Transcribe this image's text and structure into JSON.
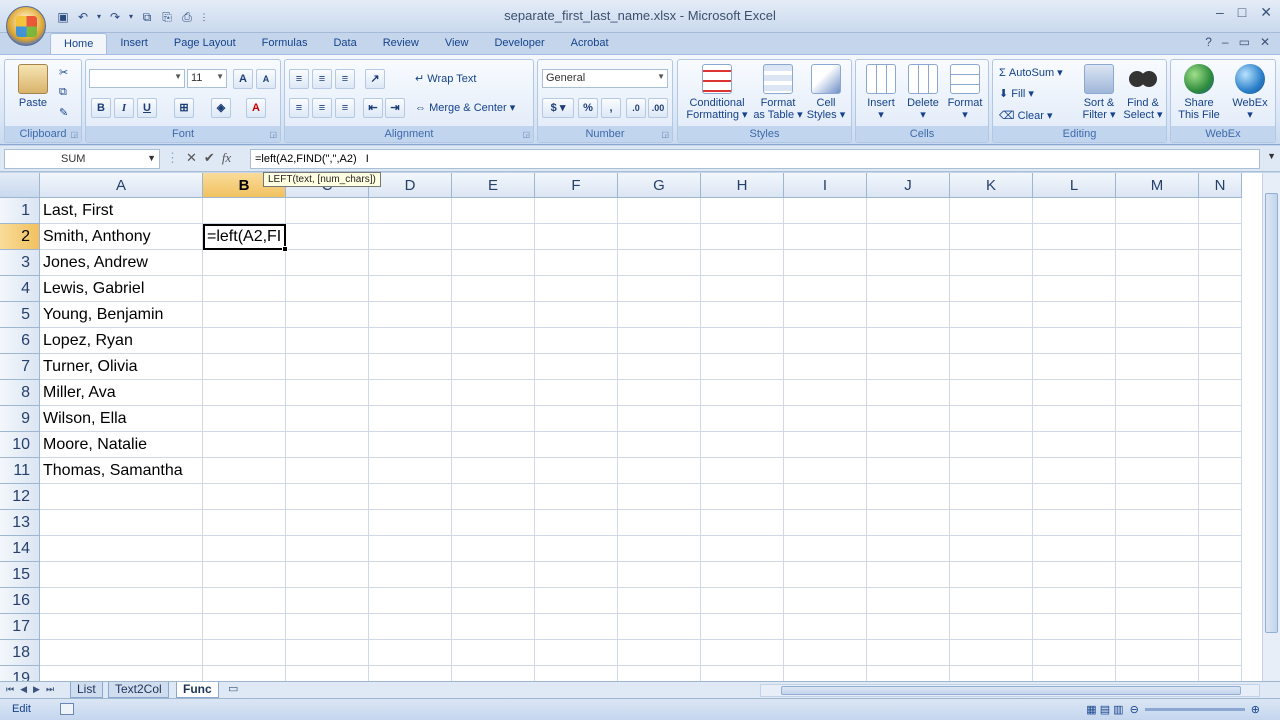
{
  "window": {
    "title": "separate_first_last_name.xlsx - Microsoft Excel",
    "controls": [
      "–",
      "□",
      "✕"
    ]
  },
  "ribbon": {
    "tabs": [
      "Home",
      "Insert",
      "Page Layout",
      "Formulas",
      "Data",
      "Review",
      "View",
      "Developer",
      "Acrobat"
    ],
    "active_tab": "Home",
    "clipboard": {
      "label": "Clipboard",
      "paste": "Paste"
    },
    "font": {
      "label": "Font",
      "name": "",
      "size": "11",
      "bold": "B",
      "italic": "I",
      "underline": "U",
      "grow": "A",
      "shrink": "A"
    },
    "alignment": {
      "label": "Alignment",
      "wrap": "Wrap Text",
      "merge": "Merge & Center"
    },
    "number": {
      "label": "Number",
      "format": "General",
      "currency": "$",
      "percent": "%",
      "comma": ","
    },
    "styles": {
      "label": "Styles",
      "conditional": "Conditional Formatting",
      "cond_l1": "Conditional",
      "cond_l2": "Formatting",
      "table_l1": "Format",
      "table_l2": "as Table",
      "cell_l1": "Cell",
      "cell_l2": "Styles"
    },
    "cells": {
      "label": "Cells",
      "insert": "Insert",
      "delete": "Delete",
      "format": "Format"
    },
    "editing": {
      "label": "Editing",
      "autosum": "AutoSum",
      "fill": "Fill",
      "clear": "Clear",
      "sort_l1": "Sort &",
      "sort_l2": "Filter",
      "find_l1": "Find &",
      "find_l2": "Select"
    },
    "webex": {
      "label": "WebEx",
      "share_l1": "Share",
      "share_l2": "This File",
      "webex": "WebEx"
    }
  },
  "formula_bar": {
    "name_box": "SUM",
    "formula": "=left(A2,FIND(\",\",A2)",
    "tooltip": "LEFT(text, [num_chars])"
  },
  "grid": {
    "columns": [
      "A",
      "B",
      "C",
      "D",
      "E",
      "F",
      "G",
      "H",
      "I",
      "J",
      "K",
      "L",
      "M",
      "N"
    ],
    "selected_column": "B",
    "rows": [
      {
        "num": "1",
        "a": "Last, First",
        "b": ""
      },
      {
        "num": "2",
        "a": "Smith, Anthony",
        "b": "=left(A2,FI"
      },
      {
        "num": "3",
        "a": "Jones, Andrew",
        "b": ""
      },
      {
        "num": "4",
        "a": "Lewis, Gabriel",
        "b": ""
      },
      {
        "num": "5",
        "a": "Young, Benjamin",
        "b": ""
      },
      {
        "num": "6",
        "a": "Lopez, Ryan",
        "b": ""
      },
      {
        "num": "7",
        "a": "Turner, Olivia",
        "b": ""
      },
      {
        "num": "8",
        "a": "Miller, Ava",
        "b": ""
      },
      {
        "num": "9",
        "a": "Wilson, Ella",
        "b": ""
      },
      {
        "num": "10",
        "a": "Moore, Natalie",
        "b": ""
      },
      {
        "num": "11",
        "a": "Thomas, Samantha",
        "b": ""
      },
      {
        "num": "12",
        "a": "",
        "b": ""
      },
      {
        "num": "13",
        "a": "",
        "b": ""
      },
      {
        "num": "14",
        "a": "",
        "b": ""
      },
      {
        "num": "15",
        "a": "",
        "b": ""
      },
      {
        "num": "16",
        "a": "",
        "b": ""
      },
      {
        "num": "17",
        "a": "",
        "b": ""
      },
      {
        "num": "18",
        "a": "",
        "b": ""
      },
      {
        "num": "19",
        "a": "",
        "b": ""
      }
    ],
    "selected_row": "2"
  },
  "sheets": {
    "tabs": [
      "List",
      "Text2Col",
      "Func"
    ],
    "active": "Func"
  },
  "status": {
    "mode": "Edit"
  }
}
